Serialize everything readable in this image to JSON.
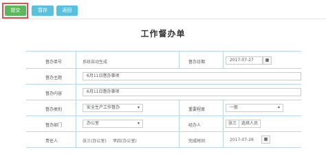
{
  "toolbar": {
    "submit_label": "提交",
    "temp_save_label": "暂存",
    "back_label": "返回"
  },
  "form_title": "工作督办单",
  "fields": {
    "sheet_no": {
      "label": "督办单号",
      "value": "系统自动生成"
    },
    "date": {
      "label": "督办日期",
      "value": "2017-07-27"
    },
    "theme": {
      "label": "督办主题",
      "value": "6月11日督办事项"
    },
    "content": {
      "label": "督办内容",
      "value": "6月11日督办事项"
    },
    "task_type": {
      "label": "督办类别",
      "value": "安全生产工作督办"
    },
    "priority": {
      "label": "重要程度",
      "value": "一般"
    },
    "dept": {
      "label": "督办部门",
      "value": "办公室"
    },
    "handler": {
      "label": "经办人",
      "value": "张三",
      "action": "选择人员"
    },
    "responsible": {
      "label": "责任人",
      "value": "张三(办公室)",
      "extra": "李四(办公室)"
    },
    "deadline": {
      "label": "完成时间",
      "value": "2017-07-28"
    }
  },
  "icons": {
    "calendar": "calendar-icon"
  }
}
